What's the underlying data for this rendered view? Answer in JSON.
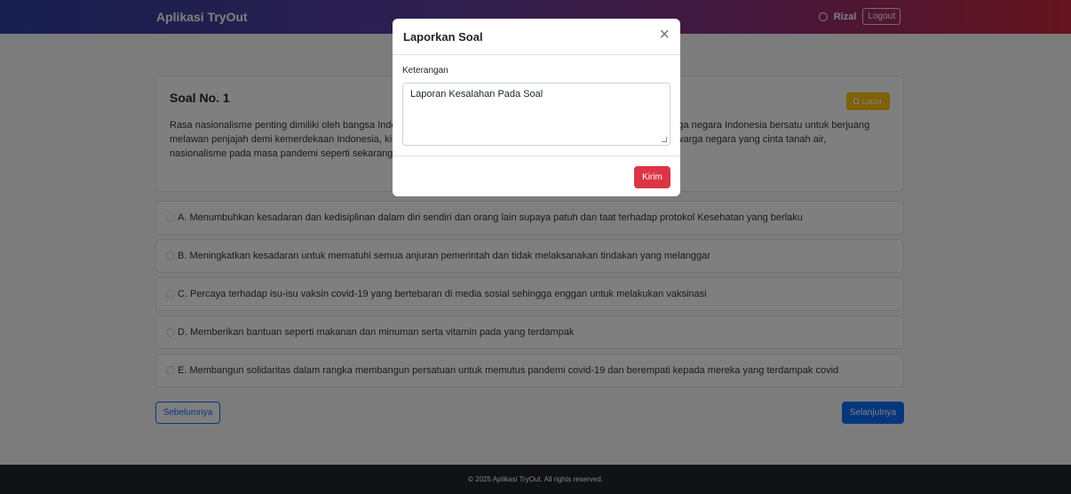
{
  "navbar": {
    "brand": "Aplikasi TryOut",
    "user_name": "Rizal",
    "logout_label": "Logout"
  },
  "question": {
    "title": "Soal No. 1",
    "text": "Rasa nasionalisme penting dimiliki oleh bangsa Indonesia. Dahulu rasa nasionalisme diwujudkan dengan seluruh warga negara Indonesia bersatu untuk berjuang melawan penjajah demi kemerdekaan Indonesia, kini setelah Indonesia merdeka rasa nasionalisme diwujudkan oleh warga negara yang cinta tanah air, nasionalisme pada masa pandemi seperti sekarang ini dapat dilakukan dengan cara ....",
    "report_label": "Lapor"
  },
  "options": [
    "A. Menumbuhkan kesadaran dan kedisiplinan dalam diri sendiri dan orang lain supaya patuh dan taat terhadap protokol Kesehatan yang berlaku",
    "B. Meningkatkan kesadaran untuk mematuhi semua anjuran pemerintah dan tidak melaksanakan tindakan yang melanggar",
    "C. Percaya terhadap isu-isu vaksin covid-19 yang bertebaran di media sosial sehingga enggan untuk melakukan vaksinasi",
    "D. Memberikan bantuan seperti makanan dan minuman serta vitamin pada yang terdampak",
    "E. Membangun solidaritas dalam rangka membangun persatuan untuk memutus pandemi covid-19 dan berempati kepada mereka yang terdampak covid"
  ],
  "navigation": {
    "prev_label": "Sebelumnya",
    "next_label": "Selanjutnya"
  },
  "footer": {
    "text": "© 2025 Aplikasi TryOut. All rights reserved."
  },
  "modal": {
    "title": "Laporkan Soal",
    "close_glyph": "×",
    "field_label": "Keterangan",
    "field_value": "Laporan Kesalahan Pada Soal",
    "submit_label": "Kirim"
  }
}
